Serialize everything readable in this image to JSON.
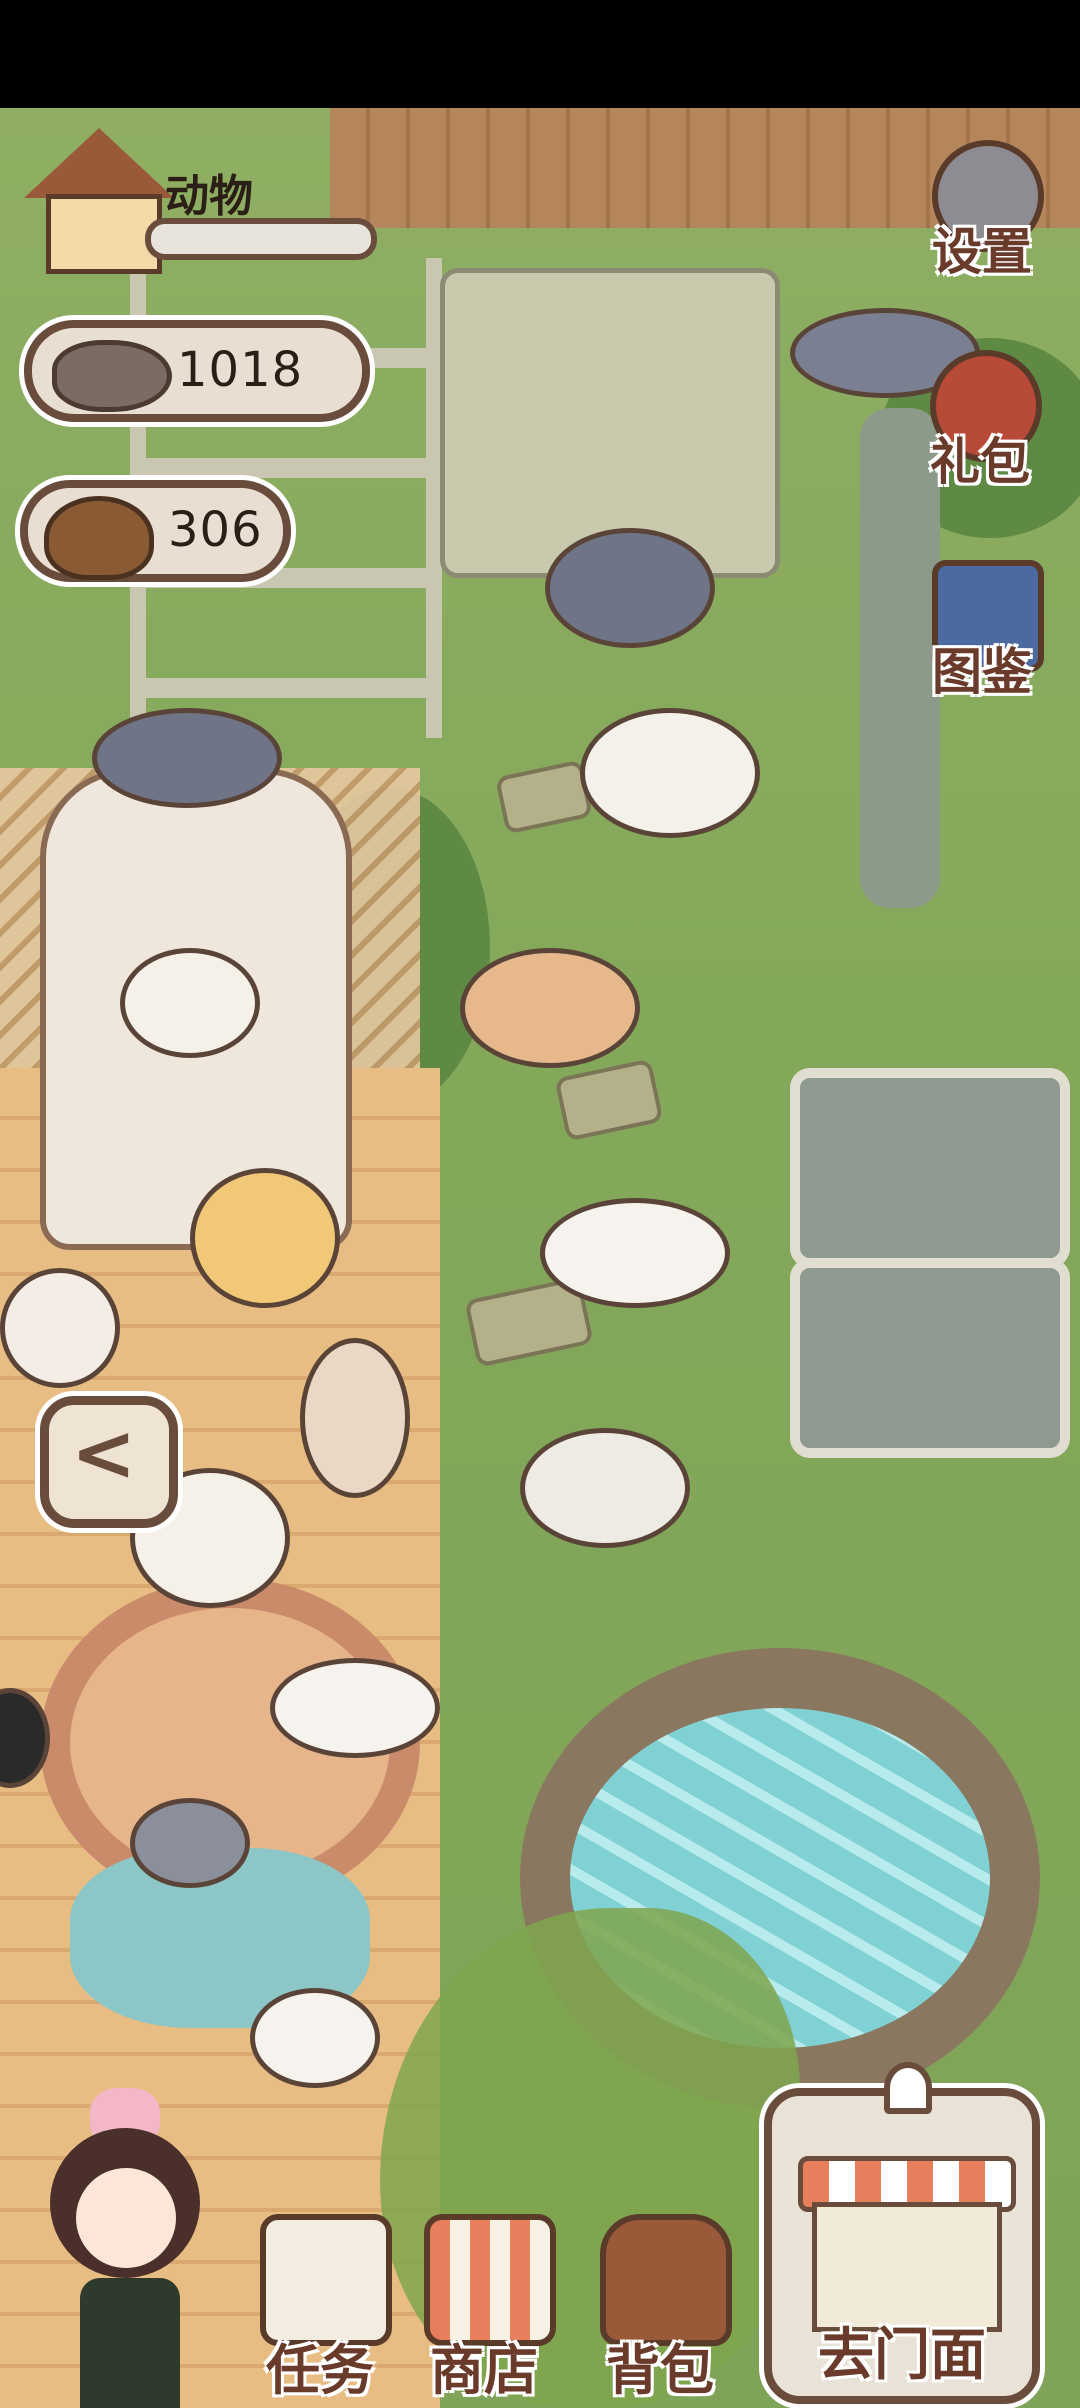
{
  "hud": {
    "animal_label": "动物",
    "fish_count": "1018",
    "poop_count": "306"
  },
  "side_menu": {
    "settings": "设置",
    "gift": "礼包",
    "catalog": "图鉴"
  },
  "bottom_menu": {
    "tasks": "任务",
    "shop": "商店",
    "backpack": "背包",
    "go_storefront": "去门面"
  },
  "nav": {
    "back_glyph": "<"
  },
  "colors": {
    "grass": "#84a85a",
    "deck": "#e8bd83",
    "ui_border": "#6a4c3c",
    "ui_fill": "#e8dfd2",
    "label_text": "#6a3a2a"
  },
  "icons": [
    "house-icon",
    "fish-icon",
    "poop-icon",
    "gear-icon",
    "gift-icon",
    "book-icon",
    "back-arrow-icon",
    "task-icon",
    "shop-icon",
    "backpack-icon",
    "storefront-icon"
  ]
}
